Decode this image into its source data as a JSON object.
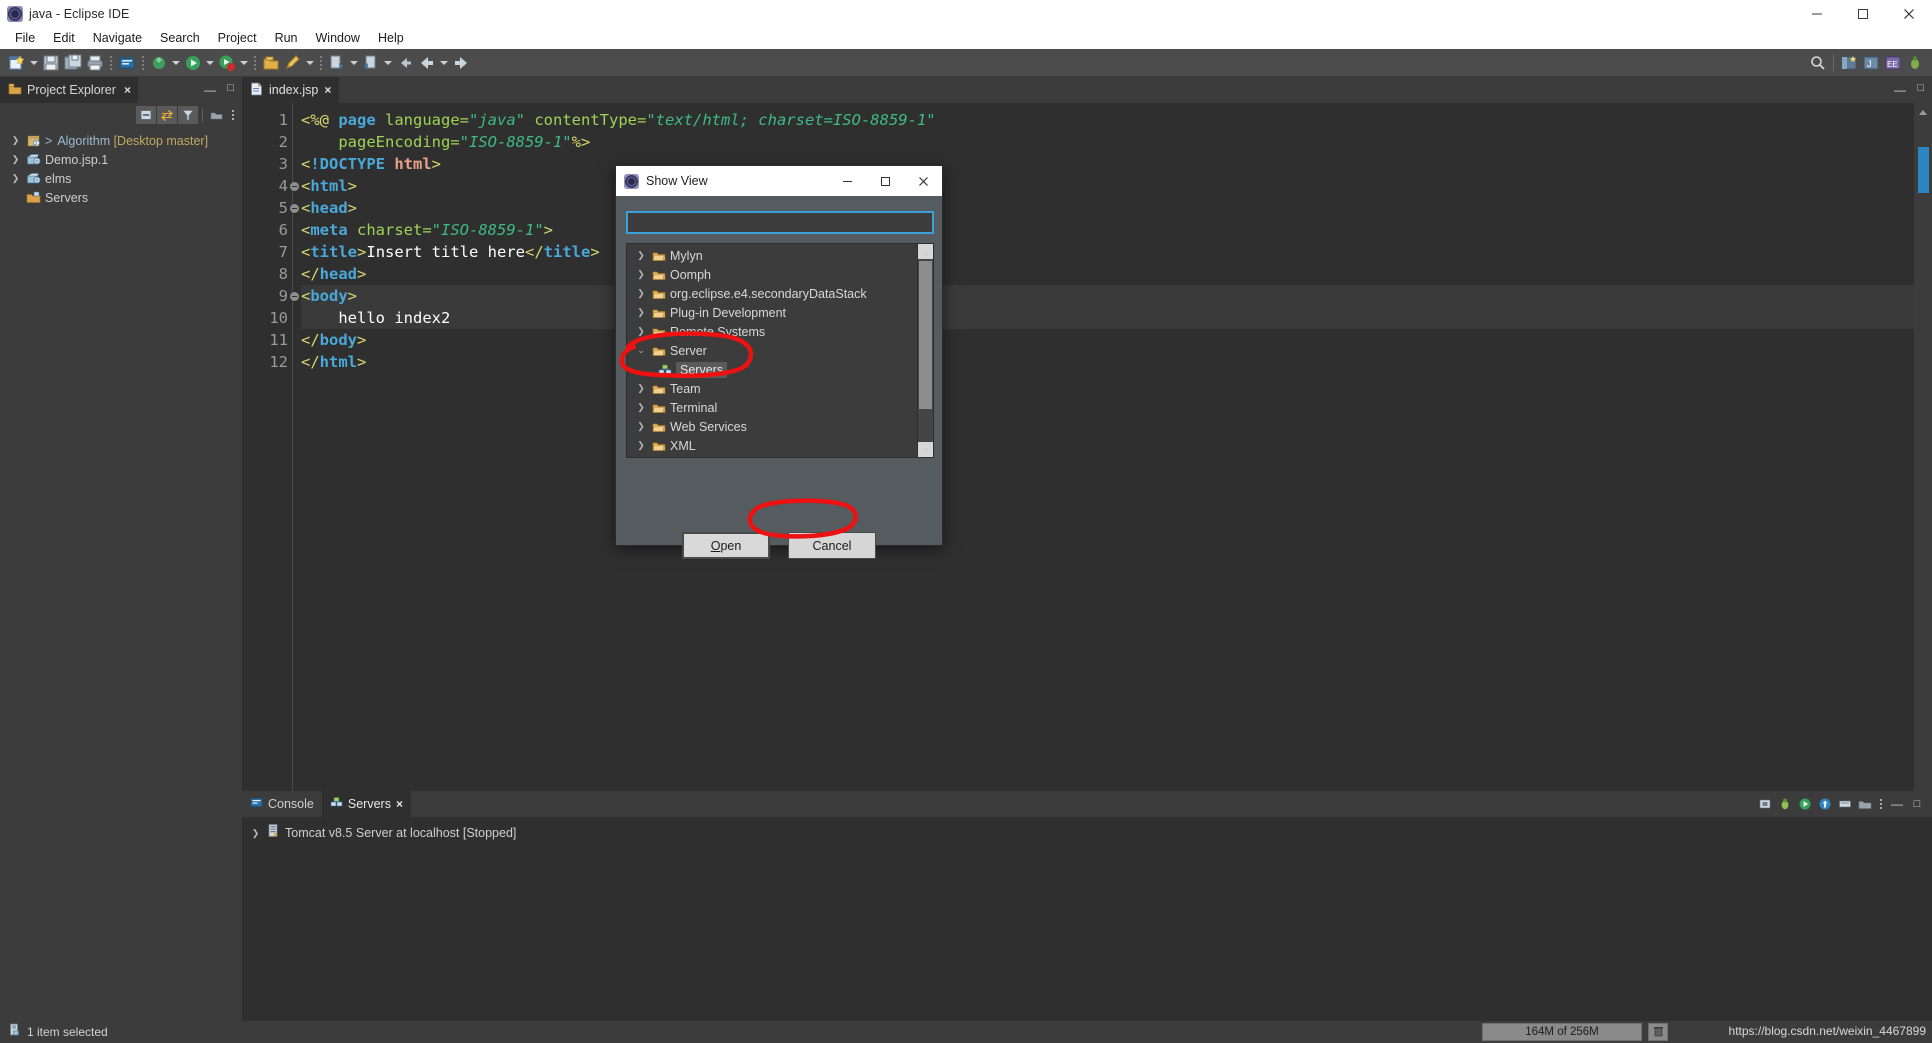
{
  "window": {
    "title": "java - Eclipse IDE",
    "icon": "eclipse-icon",
    "minimize": "minimize",
    "maximize": "maximize",
    "close": "close"
  },
  "menubar": {
    "items": [
      "File",
      "Edit",
      "Navigate",
      "Search",
      "Project",
      "Run",
      "Window",
      "Help"
    ]
  },
  "explorer": {
    "tab_label": "Project Explorer",
    "close": "×",
    "minimize": "—",
    "maximize": "□",
    "toolbar_icons": [
      "collapse-all-icon",
      "link-with-editor-icon",
      "view-filter-icon",
      "view-menu-icon",
      "view-more-icon"
    ],
    "tree": [
      {
        "label": "Algorithm",
        "suffix": " [Desktop master]",
        "prefix": ">",
        "icon": "java-project-icon",
        "expandable": true,
        "style": "project"
      },
      {
        "label": "Demo.jsp.1",
        "suffix": "",
        "prefix": "",
        "icon": "web-project-icon",
        "expandable": true,
        "style": "normal"
      },
      {
        "label": "elms",
        "suffix": "",
        "prefix": "",
        "icon": "web-project-icon",
        "expandable": true,
        "style": "normal"
      },
      {
        "label": "Servers",
        "suffix": "",
        "prefix": "",
        "icon": "servers-folder-icon",
        "expandable": false,
        "style": "normal"
      }
    ]
  },
  "editor": {
    "tab_label": "index.jsp",
    "tab_icon": "jsp-file-icon",
    "close": "×",
    "minimize": "—",
    "maximize": "□",
    "lines": [
      {
        "num": "1",
        "fold": false,
        "highlight": false,
        "tokens": [
          {
            "t": "<%@ ",
            "c": "jsp"
          },
          {
            "t": "page ",
            "c": "kw"
          },
          {
            "t": "language=",
            "c": "attr"
          },
          {
            "t": "\"java\"",
            "c": "str"
          },
          {
            "t": " ",
            "c": "plain"
          },
          {
            "t": "contentType=",
            "c": "attr"
          },
          {
            "t": "\"text/html; charset=ISO-8859-1\"",
            "c": "str"
          }
        ]
      },
      {
        "num": "2",
        "fold": false,
        "highlight": false,
        "tokens": [
          {
            "t": "    ",
            "c": "plain"
          },
          {
            "t": "pageEncoding=",
            "c": "attr"
          },
          {
            "t": "\"ISO-8859-1\"",
            "c": "str"
          },
          {
            "t": "%>",
            "c": "jsp"
          }
        ]
      },
      {
        "num": "3",
        "fold": false,
        "highlight": false,
        "tokens": [
          {
            "t": "<",
            "c": "punct"
          },
          {
            "t": "!DOCTYPE ",
            "c": "tag"
          },
          {
            "t": "html",
            "c": "doct"
          },
          {
            "t": ">",
            "c": "punct"
          }
        ]
      },
      {
        "num": "4",
        "fold": true,
        "highlight": false,
        "tokens": [
          {
            "t": "<",
            "c": "punct"
          },
          {
            "t": "html",
            "c": "tag"
          },
          {
            "t": ">",
            "c": "punct"
          }
        ]
      },
      {
        "num": "5",
        "fold": true,
        "highlight": false,
        "tokens": [
          {
            "t": "<",
            "c": "punct"
          },
          {
            "t": "head",
            "c": "tag"
          },
          {
            "t": ">",
            "c": "punct"
          }
        ]
      },
      {
        "num": "6",
        "fold": false,
        "highlight": false,
        "tokens": [
          {
            "t": "<",
            "c": "punct"
          },
          {
            "t": "meta ",
            "c": "tag"
          },
          {
            "t": "charset=",
            "c": "attr"
          },
          {
            "t": "\"ISO-8859-1\"",
            "c": "str"
          },
          {
            "t": ">",
            "c": "punct"
          }
        ]
      },
      {
        "num": "7",
        "fold": false,
        "highlight": false,
        "tokens": [
          {
            "t": "<",
            "c": "punct"
          },
          {
            "t": "title",
            "c": "tag"
          },
          {
            "t": ">",
            "c": "punct"
          },
          {
            "t": "Insert title here",
            "c": "plain"
          },
          {
            "t": "</",
            "c": "punct"
          },
          {
            "t": "title",
            "c": "tag"
          },
          {
            "t": ">",
            "c": "punct"
          }
        ]
      },
      {
        "num": "8",
        "fold": false,
        "highlight": false,
        "tokens": [
          {
            "t": "</",
            "c": "punct"
          },
          {
            "t": "head",
            "c": "tag"
          },
          {
            "t": ">",
            "c": "punct"
          }
        ]
      },
      {
        "num": "9",
        "fold": true,
        "highlight": true,
        "tokens": [
          {
            "t": "<",
            "c": "punct"
          },
          {
            "t": "body",
            "c": "tag"
          },
          {
            "t": ">",
            "c": "punct"
          }
        ]
      },
      {
        "num": "10",
        "fold": false,
        "highlight": true,
        "tokens": [
          {
            "t": "    hello index2",
            "c": "plain"
          }
        ]
      },
      {
        "num": "11",
        "fold": false,
        "highlight": false,
        "tokens": [
          {
            "t": "</",
            "c": "punct"
          },
          {
            "t": "body",
            "c": "tag"
          },
          {
            "t": ">",
            "c": "punct"
          }
        ]
      },
      {
        "num": "12",
        "fold": false,
        "highlight": false,
        "tokens": [
          {
            "t": "</",
            "c": "punct"
          },
          {
            "t": "html",
            "c": "tag"
          },
          {
            "t": ">",
            "c": "punct"
          }
        ]
      }
    ]
  },
  "bottom_panel": {
    "tabs": [
      {
        "label": "Console",
        "icon": "console-icon",
        "active": false,
        "closable": false
      },
      {
        "label": "Servers",
        "icon": "servers-icon",
        "active": true,
        "closable": true
      }
    ],
    "close": "×",
    "server_entry": "Tomcat v8.5 Server at localhost  [Stopped]",
    "server_icon": "tomcat-server-icon",
    "toolbar_icons": [
      "terminate-icon",
      "debug-icon",
      "start-icon",
      "publish-icon",
      "new-server-icon",
      "view-menu-icon",
      "view-more-icon",
      "minimize-icon",
      "maximize-icon"
    ],
    "minimize": "—",
    "maximize": "□"
  },
  "statusbar": {
    "text": "1 item selected",
    "icon": "selection-icon",
    "heap": "164M of 256M",
    "heap_button_icon": "trash-icon",
    "watermark": "https://blog.csdn.net/weixin_4467899"
  },
  "dialog": {
    "title": "Show View",
    "icon": "eclipse-icon",
    "minimize": "—",
    "maximize": "□",
    "close": "×",
    "filter_value": "",
    "filter_placeholder": "",
    "tree": [
      {
        "label": "Mylyn",
        "icon": "folder-icon",
        "expanded": false,
        "child": false
      },
      {
        "label": "Oomph",
        "icon": "folder-icon",
        "expanded": false,
        "child": false
      },
      {
        "label": "org.eclipse.e4.secondaryDataStack",
        "icon": "folder-icon",
        "expanded": false,
        "child": false
      },
      {
        "label": "Plug-in Development",
        "icon": "folder-icon",
        "expanded": false,
        "child": false
      },
      {
        "label": "Remote Systems",
        "icon": "folder-icon",
        "expanded": false,
        "child": false
      },
      {
        "label": "Server",
        "icon": "folder-icon",
        "expanded": true,
        "child": false
      },
      {
        "label": "Servers",
        "icon": "servers-icon",
        "expanded": false,
        "child": true
      },
      {
        "label": "Team",
        "icon": "folder-icon",
        "expanded": false,
        "child": false
      },
      {
        "label": "Terminal",
        "icon": "folder-icon",
        "expanded": false,
        "child": false
      },
      {
        "label": "Web Services",
        "icon": "folder-icon",
        "expanded": false,
        "child": false
      },
      {
        "label": "XML",
        "icon": "folder-icon",
        "expanded": false,
        "child": false
      }
    ],
    "open_button": "Open",
    "open_button_mnemonic": "O",
    "open_button_rest": "pen",
    "cancel_button": "Cancel"
  },
  "annotations": {
    "color": "#ee1111",
    "marks": [
      "circle-around-server-servers",
      "circle-around-open-button"
    ]
  }
}
